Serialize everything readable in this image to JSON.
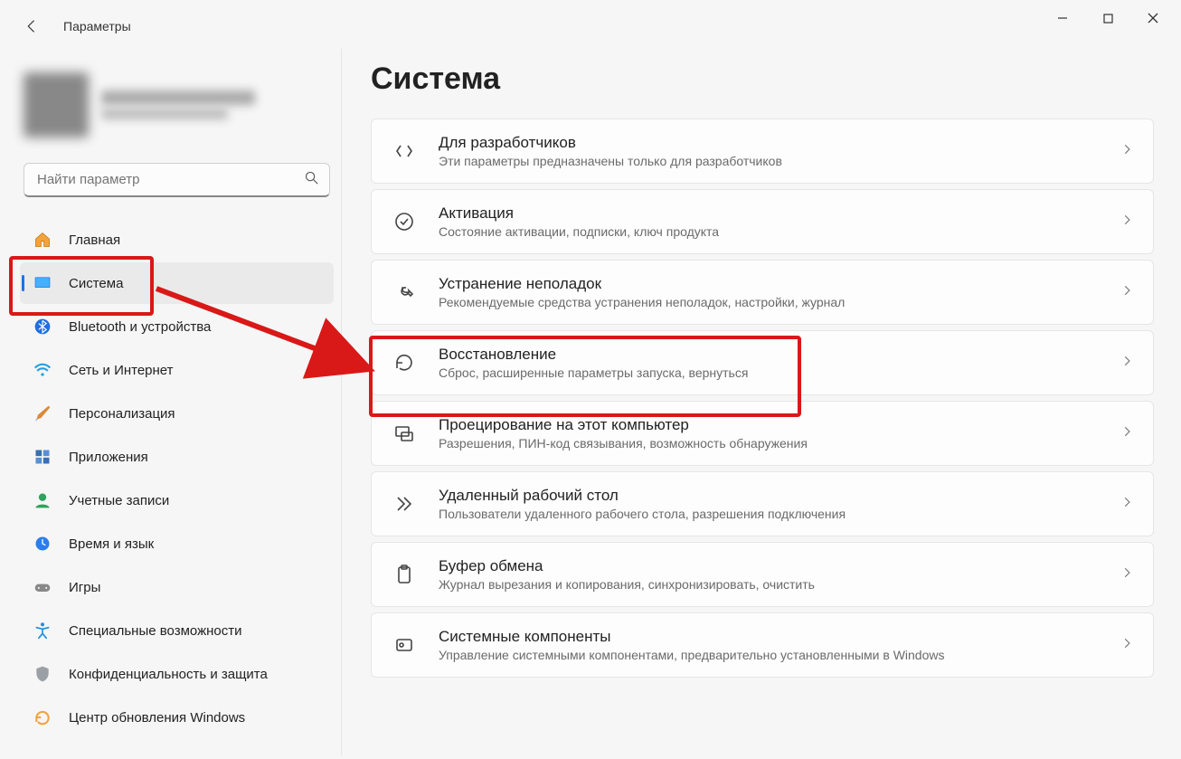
{
  "app_title": "Параметры",
  "page_title": "Система",
  "search": {
    "placeholder": "Найти параметр"
  },
  "sidebar": {
    "items": [
      {
        "id": "home",
        "label": "Главная"
      },
      {
        "id": "system",
        "label": "Система"
      },
      {
        "id": "bluetooth",
        "label": "Bluetooth и устройства"
      },
      {
        "id": "network",
        "label": "Сеть и Интернет"
      },
      {
        "id": "personalization",
        "label": "Персонализация"
      },
      {
        "id": "apps",
        "label": "Приложения"
      },
      {
        "id": "accounts",
        "label": "Учетные записи"
      },
      {
        "id": "time",
        "label": "Время и язык"
      },
      {
        "id": "gaming",
        "label": "Игры"
      },
      {
        "id": "accessibility",
        "label": "Специальные возможности"
      },
      {
        "id": "privacy",
        "label": "Конфиденциальность и защита"
      },
      {
        "id": "update",
        "label": "Центр обновления Windows"
      }
    ]
  },
  "cards": [
    {
      "id": "devs",
      "title": "Для разработчиков",
      "sub": "Эти параметры предназначены только для разработчиков"
    },
    {
      "id": "activation",
      "title": "Активация",
      "sub": "Состояние активации, подписки, ключ продукта"
    },
    {
      "id": "troubleshoot",
      "title": "Устранение неполадок",
      "sub": "Рекомендуемые средства устранения неполадок, настройки, журнал"
    },
    {
      "id": "recovery",
      "title": "Восстановление",
      "sub": "Сброс, расширенные параметры запуска, вернуться"
    },
    {
      "id": "project",
      "title": "Проецирование на этот компьютер",
      "sub": "Разрешения, ПИН-код связывания, возможность обнаружения"
    },
    {
      "id": "remote",
      "title": "Удаленный рабочий стол",
      "sub": "Пользователи удаленного рабочего стола, разрешения подключения"
    },
    {
      "id": "clipboard",
      "title": "Буфер обмена",
      "sub": "Журнал вырезания и копирования, синхронизировать, очистить"
    },
    {
      "id": "components",
      "title": "Системные компоненты",
      "sub": "Управление системными компонентами, предварительно установленными в Windows"
    }
  ]
}
